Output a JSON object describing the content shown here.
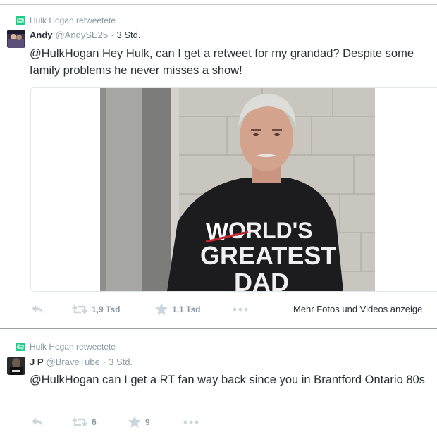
{
  "tweets": [
    {
      "retweeted_by": "Hulk Hogan retweetete",
      "name": "Andy",
      "handle": "@AndySE25",
      "separator": "·",
      "time": "3 Std.",
      "text": "@HulkHogan Hey Hulk, can I get a retweet for my grandad? Despite some family problems he never misses a show!",
      "photo_shirt_text": [
        "ORLD'S",
        "GREATEST",
        "DAD"
      ],
      "retweet_count": "1,9 Tsd",
      "favorite_count": "1,1 Tsd",
      "more_media_link": "Mehr Fotos und Videos anzeige"
    },
    {
      "retweeted_by": "Hulk Hogan retweetete",
      "name": "J P",
      "handle": "@BraveTube",
      "separator": "·",
      "time": "3 Std.",
      "text": "@HulkHogan can I get a RT fan way back since you in Brantford Ontario 80s",
      "retweet_count": "6",
      "favorite_count": "9"
    }
  ],
  "icons": {
    "retweet_badge": "retweet-icon",
    "reply": "reply-icon",
    "retweet": "retweet-icon",
    "favorite": "star-icon",
    "more": "more-icon"
  },
  "colors": {
    "text": "#292f33",
    "muted": "#8899a6",
    "retweet_green": "#19cf86",
    "action_gray": "#ccd6dd"
  }
}
